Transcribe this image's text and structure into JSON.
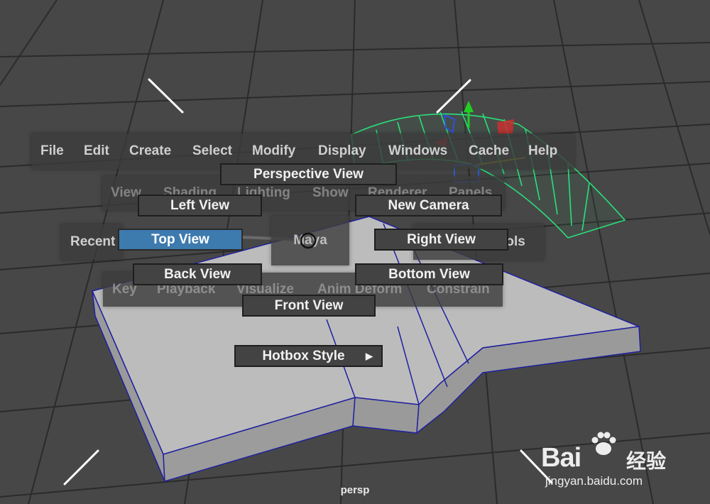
{
  "main_menu": [
    "File",
    "Edit",
    "Create",
    "Select",
    "Modify",
    "Display",
    "Windows",
    "Cache",
    "Help"
  ],
  "panel_menu": [
    "View",
    "Shading",
    "Lighting",
    "Show",
    "Renderer",
    "Panels"
  ],
  "west_zone": "Recent",
  "east_zone": "rols",
  "center_zone": "Maya",
  "anim_menu": [
    "Key",
    "Playback",
    "Visualize",
    "Anim Deform",
    "Constrain"
  ],
  "marking_menu": {
    "north": "Perspective View",
    "northwest": "Left View",
    "northeast": "New Camera",
    "west": "Top View",
    "east": "Right View",
    "southwest": "Back View",
    "southeast": "Bottom View",
    "south": "Front View",
    "hotbox_style": "Hotbox Style",
    "selected": "Top View"
  },
  "camera_label": "persp",
  "watermark": {
    "brand": "Bai",
    "chinese": "经验",
    "url": "jingyan.baidu.com"
  },
  "colors": {
    "viewport_bg": "#474747",
    "selected_item": "#3d7aae",
    "wire_blue": "#2a2ab0",
    "wire_green": "#29e07a"
  },
  "icons": [
    "paw-icon",
    "arrow-right-icon",
    "mouse-cursor-icon",
    "manipulator-icon"
  ]
}
